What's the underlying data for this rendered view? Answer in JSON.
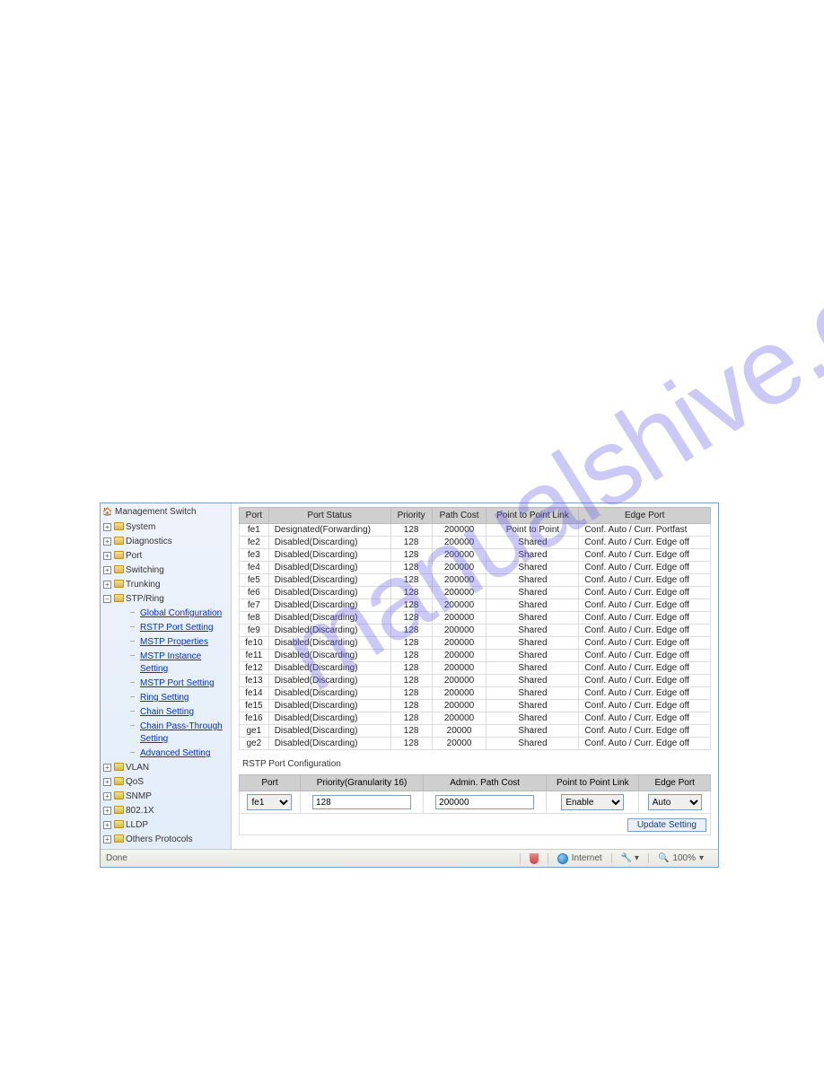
{
  "sidebar": {
    "root": "Management Switch",
    "items": [
      {
        "label": "System",
        "expanded": false
      },
      {
        "label": "Diagnostics",
        "expanded": false
      },
      {
        "label": "Port",
        "expanded": false
      },
      {
        "label": "Switching",
        "expanded": false
      },
      {
        "label": "Trunking",
        "expanded": false
      },
      {
        "label": "STP/Ring",
        "expanded": true,
        "children": [
          "Global Configuration",
          "RSTP Port Setting",
          "MSTP Properties",
          "MSTP Instance Setting",
          "MSTP Port Setting",
          "Ring Setting",
          "Chain Setting",
          "Chain Pass-Through Setting",
          "Advanced Setting"
        ]
      },
      {
        "label": "VLAN",
        "expanded": false
      },
      {
        "label": "QoS",
        "expanded": false
      },
      {
        "label": "SNMP",
        "expanded": false
      },
      {
        "label": "802.1X",
        "expanded": false
      },
      {
        "label": "LLDP",
        "expanded": false
      },
      {
        "label": "Others Protocols",
        "expanded": false
      }
    ]
  },
  "port_table": {
    "headers": [
      "Port",
      "Port Status",
      "Priority",
      "Path Cost",
      "Point to Point Link",
      "Edge Port"
    ],
    "rows": [
      {
        "port": "fe1",
        "status": "Designated(Forwarding)",
        "priority": 128,
        "cost": 200000,
        "p2p": "Point to Point",
        "edge": "Conf. Auto / Curr. Portfast"
      },
      {
        "port": "fe2",
        "status": "Disabled(Discarding)",
        "priority": 128,
        "cost": 200000,
        "p2p": "Shared",
        "edge": "Conf. Auto / Curr. Edge off"
      },
      {
        "port": "fe3",
        "status": "Disabled(Discarding)",
        "priority": 128,
        "cost": 200000,
        "p2p": "Shared",
        "edge": "Conf. Auto / Curr. Edge off"
      },
      {
        "port": "fe4",
        "status": "Disabled(Discarding)",
        "priority": 128,
        "cost": 200000,
        "p2p": "Shared",
        "edge": "Conf. Auto / Curr. Edge off"
      },
      {
        "port": "fe5",
        "status": "Disabled(Discarding)",
        "priority": 128,
        "cost": 200000,
        "p2p": "Shared",
        "edge": "Conf. Auto / Curr. Edge off"
      },
      {
        "port": "fe6",
        "status": "Disabled(Discarding)",
        "priority": 128,
        "cost": 200000,
        "p2p": "Shared",
        "edge": "Conf. Auto / Curr. Edge off"
      },
      {
        "port": "fe7",
        "status": "Disabled(Discarding)",
        "priority": 128,
        "cost": 200000,
        "p2p": "Shared",
        "edge": "Conf. Auto / Curr. Edge off"
      },
      {
        "port": "fe8",
        "status": "Disabled(Discarding)",
        "priority": 128,
        "cost": 200000,
        "p2p": "Shared",
        "edge": "Conf. Auto / Curr. Edge off"
      },
      {
        "port": "fe9",
        "status": "Disabled(Discarding)",
        "priority": 128,
        "cost": 200000,
        "p2p": "Shared",
        "edge": "Conf. Auto / Curr. Edge off"
      },
      {
        "port": "fe10",
        "status": "Disabled(Discarding)",
        "priority": 128,
        "cost": 200000,
        "p2p": "Shared",
        "edge": "Conf. Auto / Curr. Edge off"
      },
      {
        "port": "fe11",
        "status": "Disabled(Discarding)",
        "priority": 128,
        "cost": 200000,
        "p2p": "Shared",
        "edge": "Conf. Auto / Curr. Edge off"
      },
      {
        "port": "fe12",
        "status": "Disabled(Discarding)",
        "priority": 128,
        "cost": 200000,
        "p2p": "Shared",
        "edge": "Conf. Auto / Curr. Edge off"
      },
      {
        "port": "fe13",
        "status": "Disabled(Discarding)",
        "priority": 128,
        "cost": 200000,
        "p2p": "Shared",
        "edge": "Conf. Auto / Curr. Edge off"
      },
      {
        "port": "fe14",
        "status": "Disabled(Discarding)",
        "priority": 128,
        "cost": 200000,
        "p2p": "Shared",
        "edge": "Conf. Auto / Curr. Edge off"
      },
      {
        "port": "fe15",
        "status": "Disabled(Discarding)",
        "priority": 128,
        "cost": 200000,
        "p2p": "Shared",
        "edge": "Conf. Auto / Curr. Edge off"
      },
      {
        "port": "fe16",
        "status": "Disabled(Discarding)",
        "priority": 128,
        "cost": 200000,
        "p2p": "Shared",
        "edge": "Conf. Auto / Curr. Edge off"
      },
      {
        "port": "ge1",
        "status": "Disabled(Discarding)",
        "priority": 128,
        "cost": 20000,
        "p2p": "Shared",
        "edge": "Conf. Auto / Curr. Edge off"
      },
      {
        "port": "ge2",
        "status": "Disabled(Discarding)",
        "priority": 128,
        "cost": 20000,
        "p2p": "Shared",
        "edge": "Conf. Auto / Curr. Edge off"
      }
    ]
  },
  "config": {
    "title": "RSTP Port Configuration",
    "headers": [
      "Port",
      "Priority(Granularity 16)",
      "Admin. Path Cost",
      "Point to Point Link",
      "Edge Port"
    ],
    "port_value": "fe1",
    "priority_value": "128",
    "cost_value": "200000",
    "p2p_value": "Enable",
    "edge_value": "Auto",
    "button": "Update Setting"
  },
  "statusbar": {
    "done": "Done",
    "zone": "Internet",
    "zoom": "100%"
  }
}
